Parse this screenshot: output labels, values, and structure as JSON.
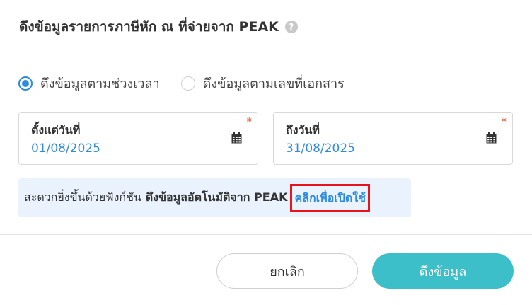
{
  "header": {
    "title": "ดึงข้อมูลรายการภาษีหัก ณ ที่จ่ายจาก PEAK",
    "help_icon": "?"
  },
  "mode": {
    "options": [
      {
        "label": "ดึงข้อมูลตามช่วงเวลา",
        "selected": true
      },
      {
        "label": "ดึงข้อมูลตามเลขที่เอกสาร",
        "selected": false
      }
    ]
  },
  "date_from": {
    "label": "ตั้งแต่วันที่",
    "value": "01/08/2025",
    "required_mark": "*"
  },
  "date_to": {
    "label": "ถึงวันที่",
    "value": "31/08/2025",
    "required_mark": "*"
  },
  "info": {
    "text": "สะดวกยิ่งขึ้นด้วยฟังก์ชัน",
    "bold_text": "ดึงข้อมูลอัตโนมัติจาก PEAK",
    "link_text": "คลิกเพื่อเปิดใช้"
  },
  "footer": {
    "cancel_label": "ยกเลิก",
    "fetch_label": "ดึงข้อมูล"
  },
  "colors": {
    "accent_blue": "#2e8bde",
    "primary_button": "#3cbfc9",
    "info_bg": "#eaf3fd",
    "highlight_border": "#e8141c"
  },
  "icons": {
    "calendar": "calendar-icon",
    "help": "help-icon"
  }
}
